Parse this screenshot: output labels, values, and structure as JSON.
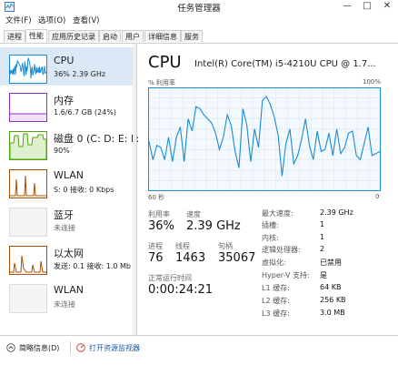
{
  "window": {
    "title": "任务管理器",
    "minimize": "—",
    "maximize": "□",
    "close": "✕"
  },
  "menu": [
    "文件(F)",
    "选项(O)",
    "查看(V)"
  ],
  "tabs": [
    "进程",
    "性能",
    "应用历史记录",
    "启动",
    "用户",
    "详细信息",
    "服务"
  ],
  "active_tab": 1,
  "sidebar": [
    {
      "title": "CPU",
      "sub": "36% 2.39 GHz",
      "color": "#1a8ad4"
    },
    {
      "title": "内存",
      "sub": "1.6/6.7 GB (24%)",
      "color": "#8b2fc9"
    },
    {
      "title": "磁盘 0 (C: D: E: F:",
      "sub": "90%",
      "color": "#4da60c"
    },
    {
      "title": "WLAN",
      "sub": "S: 0 接收: 0 Kbps",
      "color": "#a74f01"
    },
    {
      "title": "蓝牙",
      "sub": "未连接",
      "color": "#a74f01"
    },
    {
      "title": "以太网",
      "sub": "发送: 0.1 接收: 1.0 Mb",
      "color": "#a74f01"
    },
    {
      "title": "WLAN",
      "sub": "未连接",
      "color": "#a74f01"
    }
  ],
  "detail": {
    "title": "CPU",
    "model": "Intel(R) Core(TM) i5-4210U CPU @ 1.7...",
    "graph_label_left": "% 利用率",
    "graph_label_right": "100%",
    "time_left": "60 秒",
    "time_right": "0",
    "stats": {
      "util_label": "利用率",
      "util_value": "36%",
      "speed_label": "速度",
      "speed_value": "2.39 GHz",
      "proc_label": "进程",
      "proc_value": "76",
      "thread_label": "线程",
      "thread_value": "1463",
      "handle_label": "句柄",
      "handle_value": "35067",
      "uptime_label": "正常运行时间",
      "uptime_value": "0:00:24:21"
    },
    "props": [
      {
        "label": "最大速度:",
        "value": "2.39 GHz"
      },
      {
        "label": "插槽:",
        "value": "1"
      },
      {
        "label": "内核:",
        "value": "1"
      },
      {
        "label": "逻辑处理器:",
        "value": "2"
      },
      {
        "label": "虚拟化:",
        "value": "已禁用"
      },
      {
        "label": "Hyper-V 支持:",
        "value": "是"
      },
      {
        "label": "L1 缓存:",
        "value": "64 KB"
      },
      {
        "label": "L2 缓存:",
        "value": "256 KB"
      },
      {
        "label": "L3 缓存:",
        "value": "3.0 MB"
      }
    ]
  },
  "chart_data": {
    "type": "line",
    "ylim": [
      0,
      100
    ],
    "x_range_seconds": [
      60,
      0
    ],
    "values": [
      48,
      30,
      44,
      42,
      30,
      52,
      28,
      52,
      62,
      28,
      70,
      58,
      82,
      80,
      74,
      70,
      66,
      56,
      40,
      52,
      74,
      64,
      38,
      22,
      80,
      64,
      28,
      60,
      42,
      88,
      92,
      84,
      72,
      54,
      14,
      46,
      60,
      26,
      34,
      50,
      70,
      44,
      30,
      58,
      38,
      40,
      56,
      34,
      60,
      36,
      42,
      56,
      58,
      34,
      30,
      46,
      62,
      34,
      36,
      38
    ],
    "color": "#1a8ad4"
  },
  "footer": {
    "collapse": "简略信息(D)",
    "open_monitor": "打开资源监视器"
  }
}
